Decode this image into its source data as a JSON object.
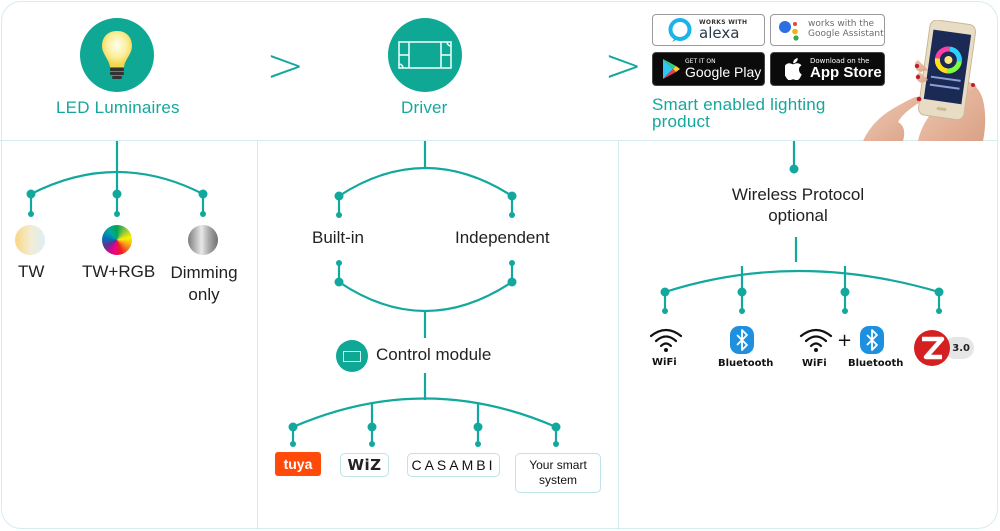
{
  "colors": {
    "teal": "#13a89e",
    "teal_circle": "#0fa895",
    "border": "#d6ecf3",
    "tuya_orange": "#ff4a0a",
    "zigbee_red": "#d42020",
    "bluetooth_blue": "#1e90e0"
  },
  "stages": [
    {
      "label": "LED Luminaires",
      "icon": "light-bulb-icon"
    },
    {
      "label": "Driver",
      "icon": "driver-icon"
    },
    {
      "label": "Smart enabled lighting product",
      "line1": "Smart enabled lighting",
      "line2": "product",
      "icon": "phone-app-icon"
    }
  ],
  "separators": [
    ">",
    ">"
  ],
  "badges": {
    "alexa": {
      "small": "WORKS WITH",
      "big": "alexa"
    },
    "google_assistant": {
      "line1": "works with the",
      "line2": "Google Assistant"
    },
    "google_play": {
      "small": "GET IT ON",
      "big": "Google Play"
    },
    "app_store": {
      "small": "Download on the",
      "big": "App Store"
    }
  },
  "luminaires": {
    "options": [
      {
        "label": "TW",
        "swatch": "tunable-white"
      },
      {
        "label": "TW+RGB",
        "swatch": "rgb-wheel"
      },
      {
        "label_line1": "Dimming",
        "label_line2": "only",
        "swatch": "silver"
      }
    ]
  },
  "driver": {
    "options": [
      "Built-in",
      "Independent"
    ],
    "control_module": "Control module",
    "platforms": [
      {
        "label": "tuya",
        "style": "tuya"
      },
      {
        "label": "WiZ",
        "style": "wiz"
      },
      {
        "label": "CASAMBI",
        "style": "casambi"
      },
      {
        "line1": "Your smart",
        "line2": "system",
        "style": "custom"
      }
    ]
  },
  "wireless": {
    "title_line1": "Wireless Protocol",
    "title_line2": "optional",
    "protocols": [
      {
        "label": "WiFi",
        "icon": "wifi-icon"
      },
      {
        "label": "Bluetooth",
        "icon": "bluetooth-icon"
      },
      {
        "label_a": "WiFi",
        "plus": "+",
        "label_b": "Bluetooth",
        "icon": "wifi-bluetooth-icon"
      },
      {
        "version": "3.0",
        "icon": "zigbee-icon"
      }
    ]
  }
}
